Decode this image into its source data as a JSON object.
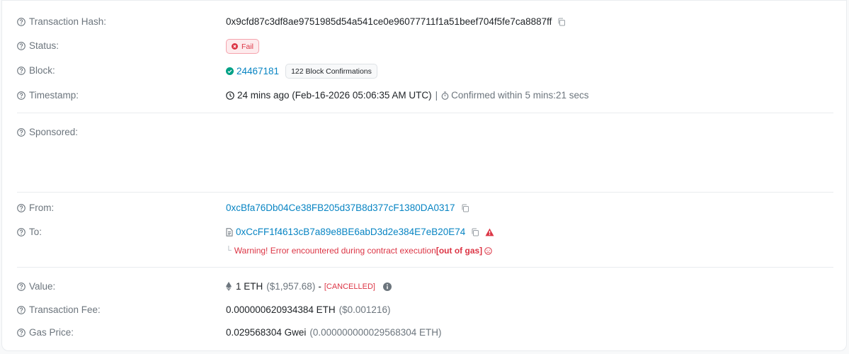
{
  "labels": {
    "tx_hash": "Transaction Hash:",
    "status": "Status:",
    "block": "Block:",
    "timestamp": "Timestamp:",
    "sponsored": "Sponsored:",
    "from": "From:",
    "to": "To:",
    "value": "Value:",
    "tx_fee": "Transaction Fee:",
    "gas_price": "Gas Price:"
  },
  "tx_hash": "0x9cfd87c3df8ae9751985d54a541ce0e96077711f1a51beef704f5fe7ca8887ff",
  "status": "Fail",
  "block": {
    "number": "24467181",
    "confirmations": "122 Block Confirmations"
  },
  "timestamp": {
    "relative": "24 mins ago (Feb-16-2026 05:06:35 AM UTC)",
    "separator": "|",
    "confirmed": "Confirmed within 5 mins:21 secs"
  },
  "from": "0xcBfa76Db04Ce38FB205d37B8d377cF1380DA0317",
  "to": {
    "address": "0xCcFF1f4613cB7a89e8BE6abD3d2e384E7eB20E74",
    "warning_prefix": "Warning! Error encountered during contract execution ",
    "warning_reason": "[out of gas]"
  },
  "value": {
    "amount": "1 ETH",
    "usd": "($1,957.68)",
    "dash": "-",
    "cancelled": "[CANCELLED]"
  },
  "tx_fee": {
    "eth": "0.000000620934384 ETH",
    "usd": "($0.001216)"
  },
  "gas_price": {
    "gwei": "0.029568304 Gwei",
    "eth": "(0.000000000029568304 ETH)"
  },
  "icons": {
    "help": "question-circle-icon",
    "copy": "copy-icon",
    "success": "check-circle-icon",
    "fail": "x-circle-icon",
    "clock": "clock-icon",
    "stopwatch": "stopwatch-icon",
    "contract": "document-icon",
    "alert": "warning-triangle-icon",
    "eth": "ethereum-icon",
    "info": "info-icon",
    "sad": "sad-face-icon"
  },
  "colors": {
    "link": "#0784c3",
    "danger": "#dc3545",
    "success": "#00a186",
    "muted": "#6c757d"
  }
}
